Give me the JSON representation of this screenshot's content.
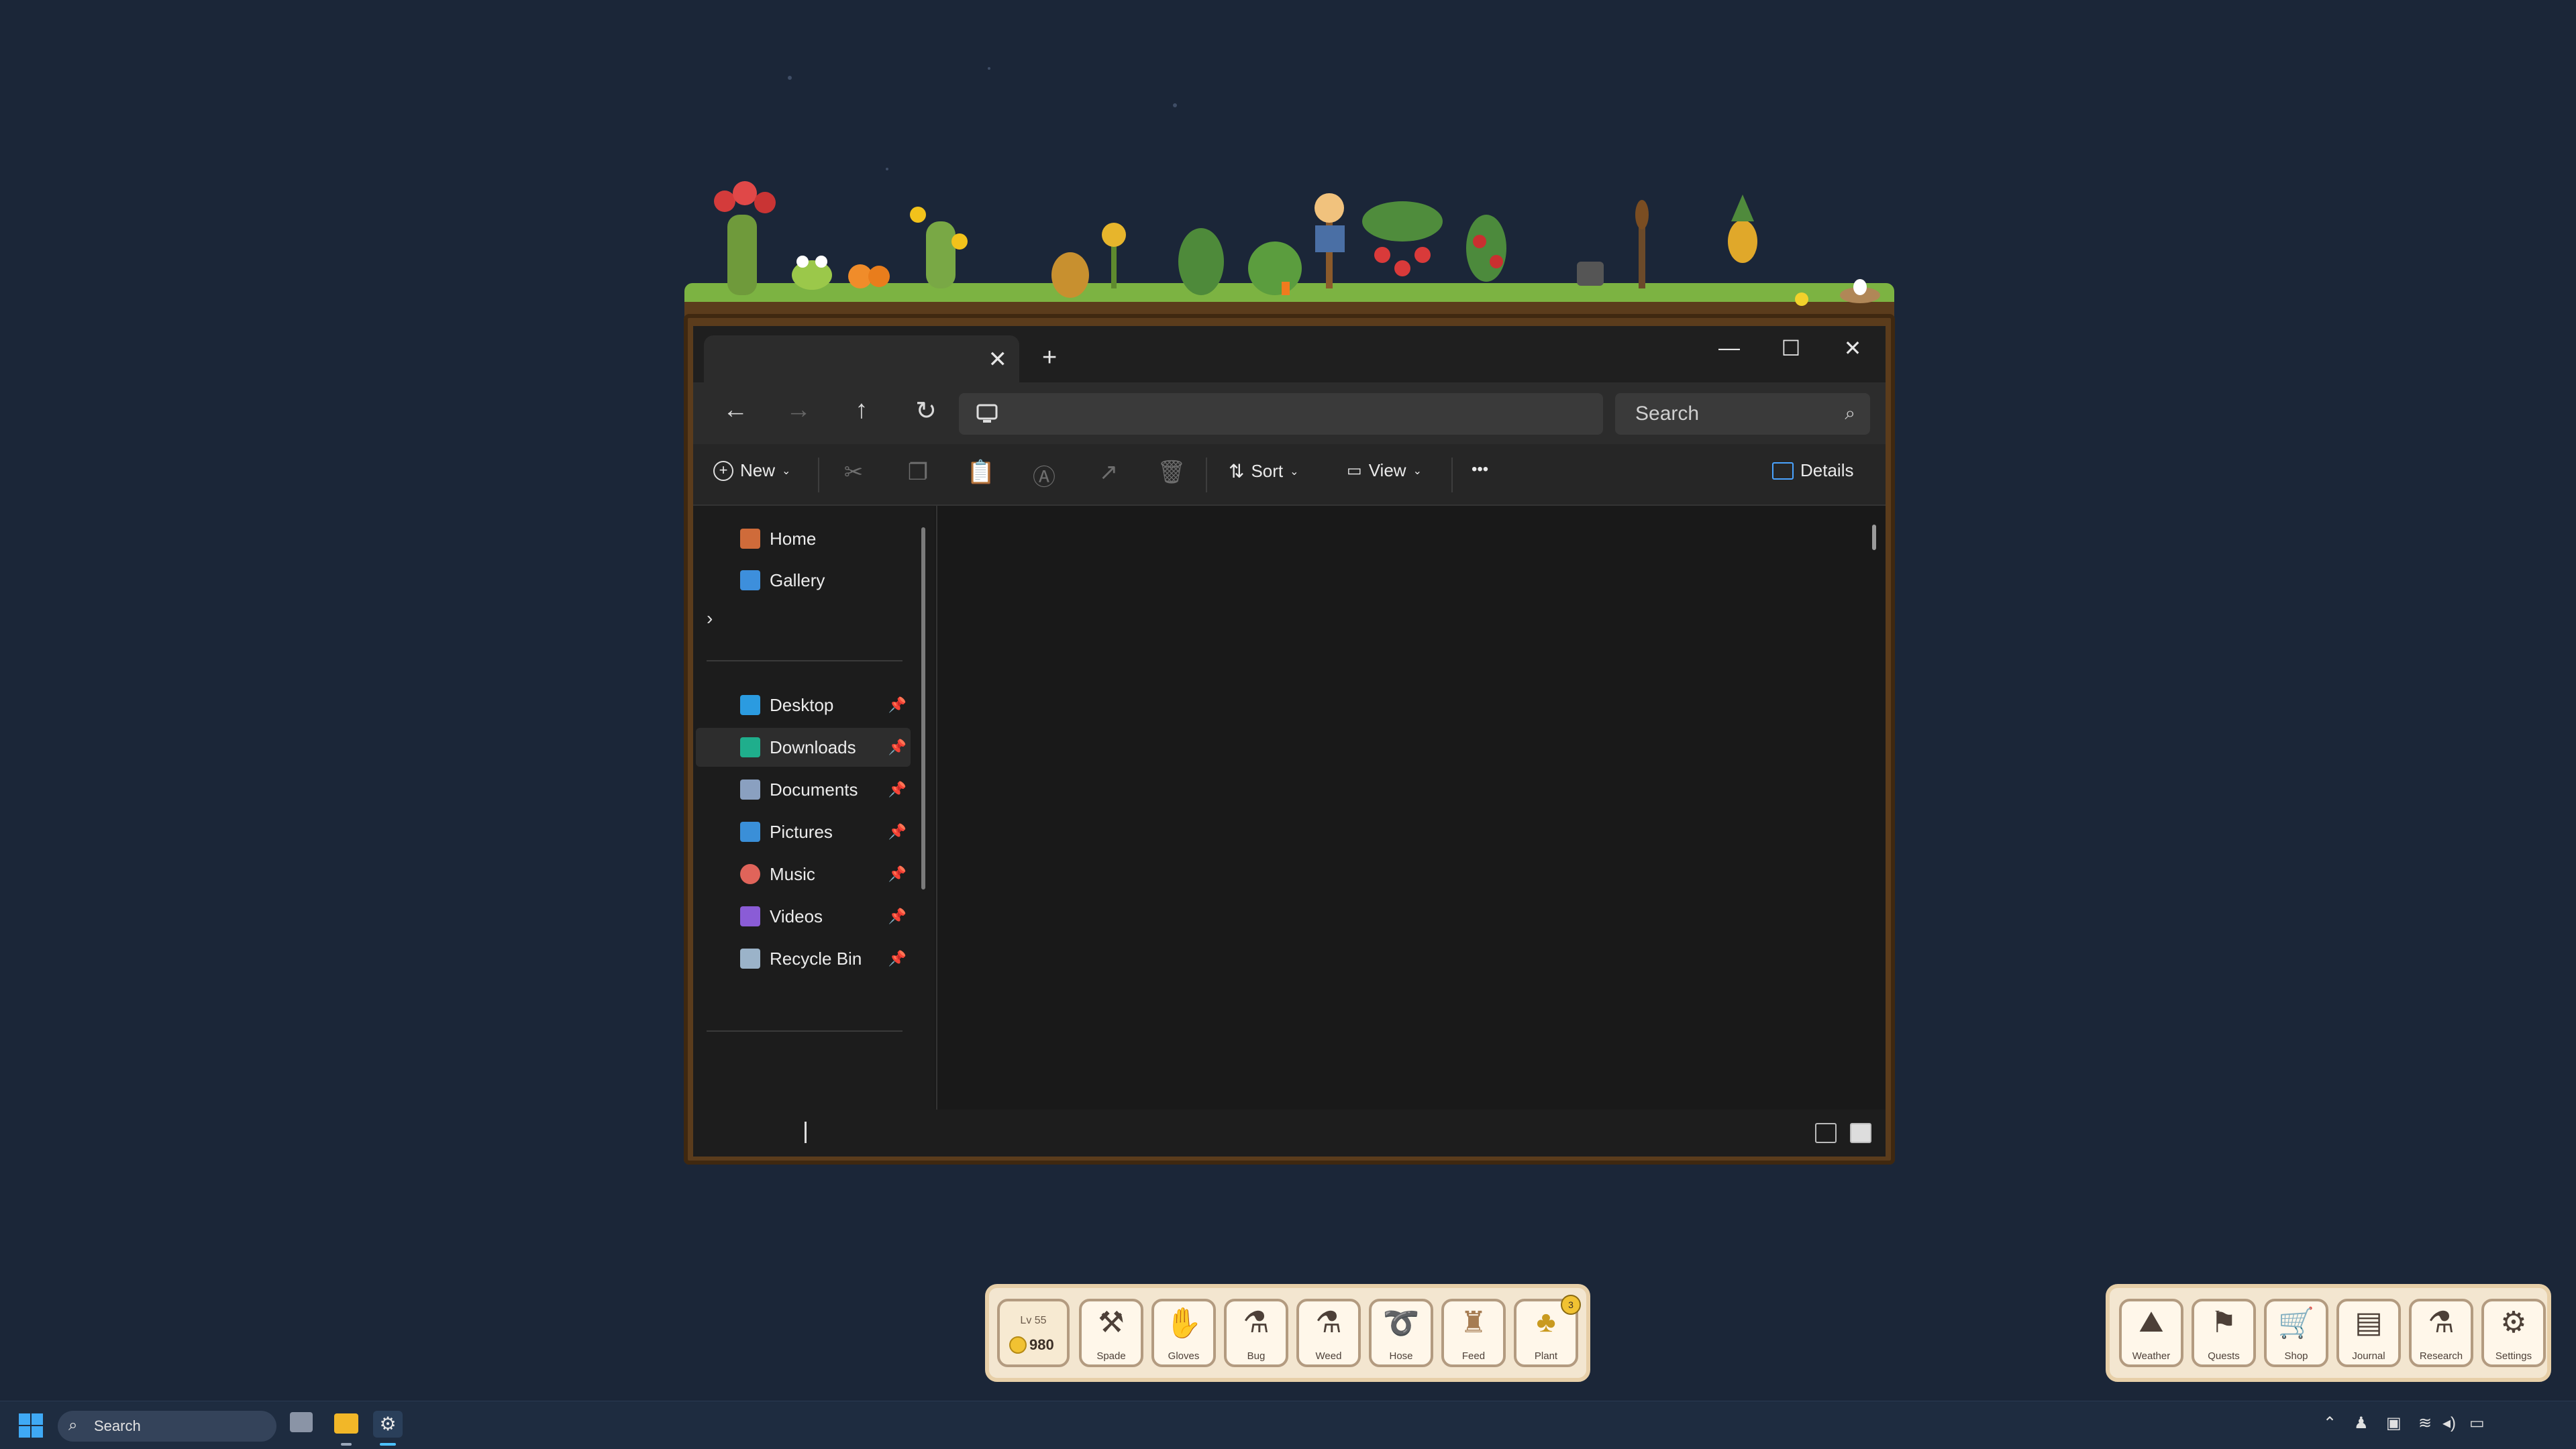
{
  "explorer": {
    "tab_title": "",
    "new_tab_symbol": "+",
    "address_value": "",
    "search_placeholder": "Search",
    "commands": {
      "new": "New",
      "sort": "Sort",
      "view": "View",
      "more": "•••",
      "details": "Details"
    },
    "sidebar": {
      "top": [
        {
          "label": "Home",
          "icon": "home-icon"
        },
        {
          "label": "Gallery",
          "icon": "gallery-icon"
        }
      ],
      "quick_access": [
        {
          "label": "Desktop",
          "icon": "desktop-folder-icon",
          "color": "#2b9be0"
        },
        {
          "label": "Downloads",
          "icon": "downloads-folder-icon",
          "color": "#1fae8c",
          "selected": true
        },
        {
          "label": "Documents",
          "icon": "documents-folder-icon",
          "color": "#8aa0c0"
        },
        {
          "label": "Pictures",
          "icon": "pictures-folder-icon",
          "color": "#3a8fd8"
        },
        {
          "label": "Music",
          "icon": "music-folder-icon",
          "color": "#e0645a"
        },
        {
          "label": "Videos",
          "icon": "videos-folder-icon",
          "color": "#8a5cd6"
        },
        {
          "label": "Recycle Bin",
          "icon": "recycle-bin-icon",
          "color": "#9bb3c9"
        }
      ]
    }
  },
  "garden_toolbar": {
    "level": "Lv 55",
    "coins": "980",
    "tools": [
      {
        "label": "Spade",
        "icon": "spade-icon"
      },
      {
        "label": "Gloves",
        "icon": "gloves-icon"
      },
      {
        "label": "Bug",
        "icon": "bug-spray-icon"
      },
      {
        "label": "Weed",
        "icon": "weed-spray-icon"
      },
      {
        "label": "Hose",
        "icon": "hose-icon"
      },
      {
        "label": "Feed",
        "icon": "feed-bag-icon"
      },
      {
        "label": "Plant",
        "icon": "plant-icon",
        "badge": "3"
      }
    ]
  },
  "menu_toolbar": {
    "items": [
      {
        "label": "Weather",
        "icon": "weather-icon"
      },
      {
        "label": "Quests",
        "icon": "quests-icon"
      },
      {
        "label": "Shop",
        "icon": "shop-cart-icon"
      },
      {
        "label": "Journal",
        "icon": "journal-icon"
      },
      {
        "label": "Research",
        "icon": "research-flask-icon"
      },
      {
        "label": "Settings",
        "icon": "settings-gear-icon"
      }
    ]
  },
  "taskbar": {
    "search_label": "Search"
  },
  "colors": {
    "desktop_bg": "#1b2638",
    "frame": "#5b3c1c",
    "grass": "#7cb342",
    "toolbar_bg": "#f3e6d0"
  }
}
